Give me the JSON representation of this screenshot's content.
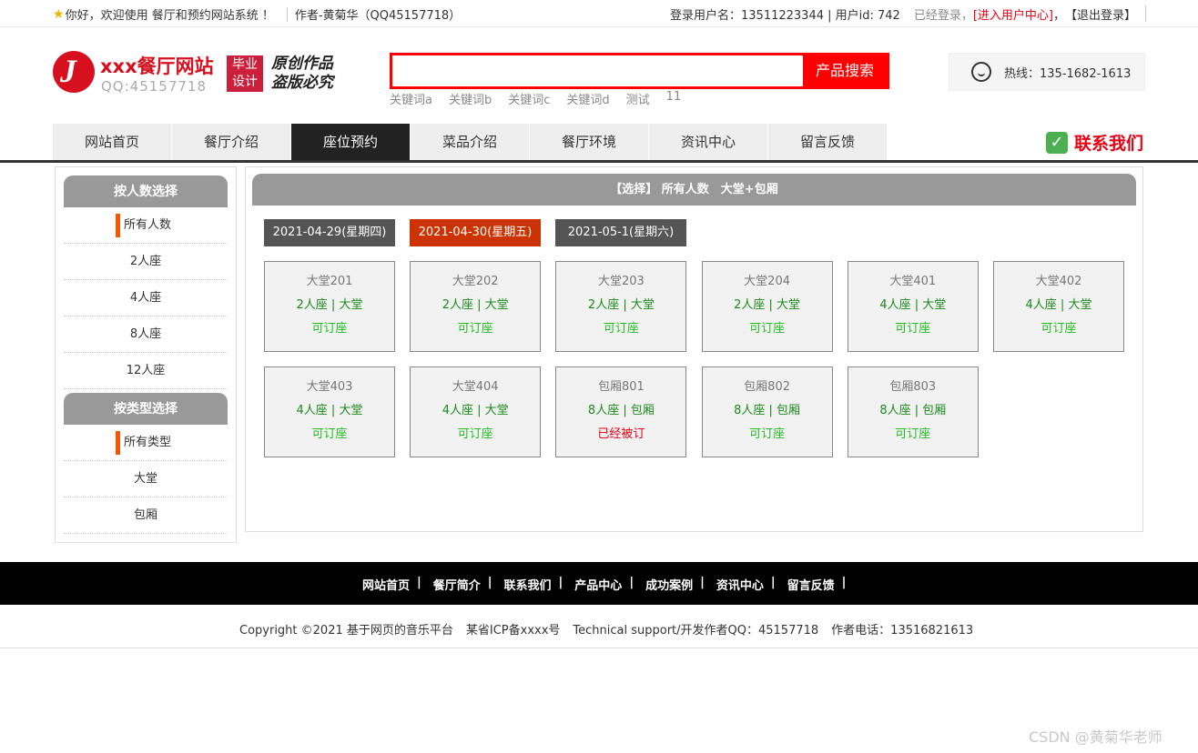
{
  "topbar": {
    "welcome": "你好，欢迎使用 餐厅和预约网站系统 ！",
    "author": "作者-黄菊华（QQ45157718）",
    "login_info": "登录用户名：13511223344 | 用户id: 742",
    "logged_in": "已经登录，",
    "user_center": "[进入用户中心]",
    "comma": "，",
    "logout": "【退出登录】"
  },
  "header": {
    "logo_letter": "J",
    "logo_name": "xxx餐厅网站",
    "logo_qq": "QQ:45157718",
    "badge_line1": "毕业",
    "badge_line2": "设计",
    "slogan_line1": "原创作品",
    "slogan_line2": "盗版必究",
    "search": {
      "value": "",
      "placeholder": "",
      "button": "产品搜索"
    },
    "keywords": [
      "关键词a",
      "关键词b",
      "关键词c",
      "关键词d",
      "测试",
      "11"
    ],
    "hotline": "热线：135-1682-1613"
  },
  "nav": {
    "items": [
      "网站首页",
      "餐厅介绍",
      "座位预约",
      "菜品介绍",
      "餐厅环境",
      "资讯中心",
      "留言反馈"
    ],
    "active_index": 2,
    "contact": "联系我们"
  },
  "sidebar": {
    "people_title": "按人数选择",
    "people_items": [
      "所有人数",
      "2人座",
      "4人座",
      "8人座",
      "12人座"
    ],
    "type_title": "按类型选择",
    "type_items": [
      "所有类型",
      "大堂",
      "包厢"
    ]
  },
  "main": {
    "filter_title": "【选择】 所有人数　大堂+包厢",
    "dates": [
      "2021-04-29(星期四)",
      "2021-04-30(星期五)",
      "2021-05-1(星期六)"
    ],
    "active_date_index": 1,
    "seats": [
      {
        "name": "大堂201",
        "type": "2人座 | 大堂",
        "status": "可订座",
        "booked": false
      },
      {
        "name": "大堂202",
        "type": "2人座 | 大堂",
        "status": "可订座",
        "booked": false
      },
      {
        "name": "大堂203",
        "type": "2人座 | 大堂",
        "status": "可订座",
        "booked": false
      },
      {
        "name": "大堂204",
        "type": "2人座 | 大堂",
        "status": "可订座",
        "booked": false
      },
      {
        "name": "大堂401",
        "type": "4人座 | 大堂",
        "status": "可订座",
        "booked": false
      },
      {
        "name": "大堂402",
        "type": "4人座 | 大堂",
        "status": "可订座",
        "booked": false
      },
      {
        "name": "大堂403",
        "type": "4人座 | 大堂",
        "status": "可订座",
        "booked": false
      },
      {
        "name": "大堂404",
        "type": "4人座 | 大堂",
        "status": "可订座",
        "booked": false
      },
      {
        "name": "包厢801",
        "type": "8人座 | 包厢",
        "status": "已经被订",
        "booked": true
      },
      {
        "name": "包厢802",
        "type": "8人座 | 包厢",
        "status": "可订座",
        "booked": false
      },
      {
        "name": "包厢803",
        "type": "8人座 | 包厢",
        "status": "可订座",
        "booked": false
      }
    ]
  },
  "footer": {
    "links": [
      "网站首页",
      "餐厅简介",
      "联系我们",
      "产品中心",
      "成功案例",
      "资讯中心",
      "留言反馈"
    ],
    "copyright": "Copyright ©2021 基于网页的音乐平台",
    "icp": "某省ICP备xxxx号",
    "support": "Technical support/开发作者QQ：45157718",
    "phone": "作者电话：13516821613"
  },
  "watermark": "CSDN @黄菊华老师",
  "colors": {
    "brand_red": "#e60012",
    "active_date": "#cc3300",
    "available": "#22bb22",
    "booked": "#e60012",
    "nav_active": "#222222"
  }
}
